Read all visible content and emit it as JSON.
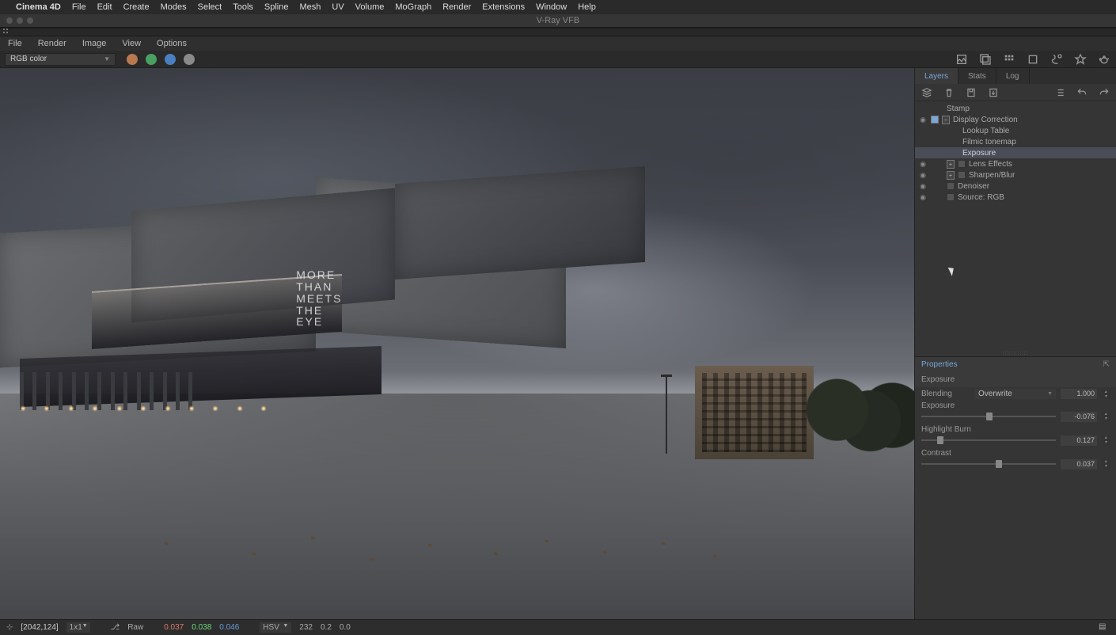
{
  "menubar": {
    "app": "Cinema 4D",
    "items": [
      "File",
      "Edit",
      "Create",
      "Modes",
      "Select",
      "Tools",
      "Spline",
      "Mesh",
      "UV",
      "Volume",
      "MoGraph",
      "Render",
      "Extensions",
      "Window",
      "Help"
    ]
  },
  "window": {
    "title": "V-Ray VFB"
  },
  "submenu": [
    "File",
    "Render",
    "Image",
    "View",
    "Options"
  ],
  "optrow": {
    "channel_dropdown": "RGB color",
    "channel_colors": [
      "#b87850",
      "#4aa060",
      "#4a80c0",
      "#b0b0b0"
    ]
  },
  "side": {
    "tabs": [
      "Layers",
      "Stats",
      "Log"
    ],
    "active_tab": 0,
    "layers": [
      {
        "depth": 1,
        "vis": false,
        "tog": false,
        "exp": "",
        "label": "Stamp",
        "sel": false
      },
      {
        "depth": 0,
        "vis": true,
        "tog": true,
        "exp": "−",
        "label": "Display Correction",
        "sel": false
      },
      {
        "depth": 2,
        "vis": false,
        "tog": false,
        "exp": "",
        "label": "Lookup Table",
        "sel": false
      },
      {
        "depth": 2,
        "vis": false,
        "tog": false,
        "exp": "",
        "label": "Filmic tonemap",
        "sel": false
      },
      {
        "depth": 2,
        "vis": false,
        "tog": false,
        "exp": "",
        "label": "Exposure",
        "sel": true
      },
      {
        "depth": 1,
        "vis": true,
        "tog": false,
        "exp": "+",
        "label": "Lens Effects",
        "sel": false,
        "icon": true
      },
      {
        "depth": 1,
        "vis": true,
        "tog": false,
        "exp": "+",
        "label": "Sharpen/Blur",
        "sel": false,
        "icon": true
      },
      {
        "depth": 1,
        "vis": true,
        "tog": false,
        "exp": "",
        "label": "Denoiser",
        "sel": false,
        "icon": true
      },
      {
        "depth": 1,
        "vis": true,
        "tog": false,
        "exp": "",
        "label": "Source: RGB",
        "sel": false,
        "icon": true
      }
    ]
  },
  "properties": {
    "title": "Properties",
    "layer_name": "Exposure",
    "blending_label": "Blending",
    "blending_value": "Overwrite",
    "blending_amount": "1.000",
    "sliders": [
      {
        "label": "Exposure",
        "value": "-0.076",
        "pos": 48
      },
      {
        "label": "Highlight Burn",
        "value": "0.127",
        "pos": 12
      },
      {
        "label": "Contrast",
        "value": "0.037",
        "pos": 55
      }
    ]
  },
  "status": {
    "coords": "[2042,124]",
    "zoom": "1x1",
    "mode": "Raw",
    "r": "0.037",
    "g": "0.038",
    "b": "0.046",
    "space": "HSV",
    "h": "232",
    "s": "0.2",
    "v": "0.0"
  },
  "walltext": [
    "MORE",
    "THAN",
    "MEETS",
    "THE",
    "EYE"
  ]
}
